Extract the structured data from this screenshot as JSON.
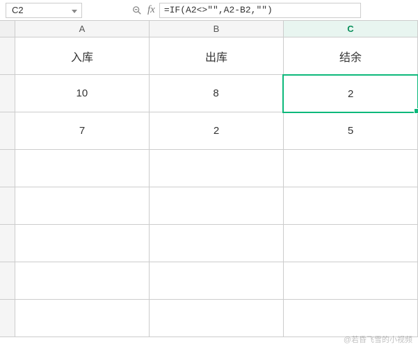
{
  "formula_bar": {
    "cell_ref": "C2",
    "fx_label": "fx",
    "formula": "=IF(A2<>\"\",A2-B2,\"\")"
  },
  "columns": [
    "A",
    "B",
    "C"
  ],
  "selected_column_index": 2,
  "selected_cell": "C2",
  "headers": {
    "a": "入库",
    "b": "出库",
    "c": "结余"
  },
  "rows": [
    {
      "a": "10",
      "b": "8",
      "c": "2"
    },
    {
      "a": "7",
      "b": "2",
      "c": "5"
    },
    {
      "a": "",
      "b": "",
      "c": ""
    },
    {
      "a": "",
      "b": "",
      "c": ""
    },
    {
      "a": "",
      "b": "",
      "c": ""
    },
    {
      "a": "",
      "b": "",
      "c": ""
    },
    {
      "a": "",
      "b": "",
      "c": ""
    }
  ],
  "watermark": "@若昏飞雪的小视频",
  "chart_data": {
    "type": "table",
    "columns": [
      "入库",
      "出库",
      "结余"
    ],
    "data": [
      [
        10,
        8,
        2
      ],
      [
        7,
        2,
        5
      ]
    ]
  }
}
